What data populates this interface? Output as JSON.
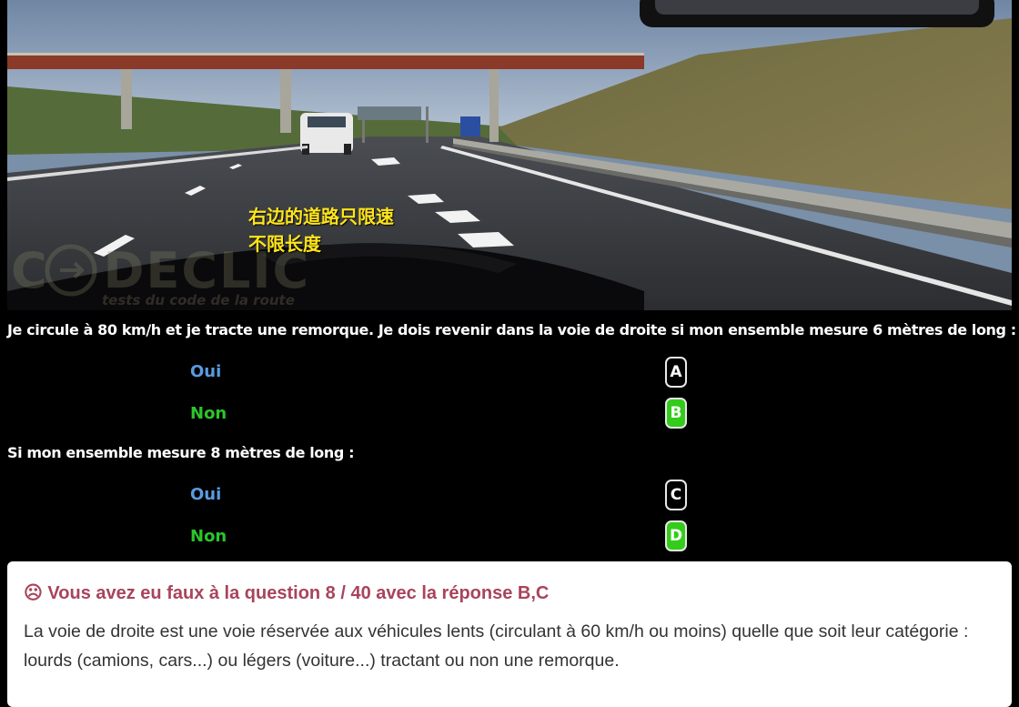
{
  "photo": {
    "overlay_line1": "右边的道路只限速",
    "overlay_line2": "不限长度",
    "watermark_main": "CODECLIC",
    "watermark_sub": "tests du code de la route"
  },
  "questions": [
    {
      "text": "Je circule à 80 km/h et je tracte une remorque. Je dois revenir dans la voie de droite si mon ensemble mesure 6 mètres de long :",
      "answers": [
        {
          "label": "Oui",
          "letter": "A",
          "correct": false
        },
        {
          "label": "Non",
          "letter": "B",
          "correct": true
        }
      ]
    },
    {
      "text": "Si mon ensemble mesure 8 mètres de long :",
      "answers": [
        {
          "label": "Oui",
          "letter": "C",
          "correct": false
        },
        {
          "label": "Non",
          "letter": "D",
          "correct": true
        }
      ]
    }
  ],
  "feedback": {
    "icon": "sad-face-icon",
    "title": "☹ Vous avez eu faux à la question 8 / 40 avec la réponse B,C",
    "body": "La voie de droite est une voie réservée aux véhicules lents (circulant à 60 km/h ou moins) quelle que soit leur catégorie : lourds (camions, cars...) ou légers (voiture...) tractant ou non une remorque."
  },
  "colors": {
    "oui": "#5a9be0",
    "non": "#2cc42c",
    "correct_button": "#33cc1a",
    "feedback_title": "#a8445c",
    "overlay_text": "#ffe51a"
  }
}
